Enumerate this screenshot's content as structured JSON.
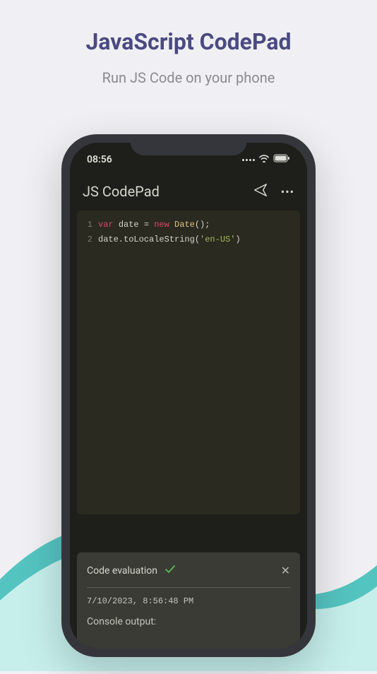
{
  "marketing": {
    "title": "JavaScript CodePad",
    "subtitle": "Run JS Code on your phone"
  },
  "phone": {
    "status_time": "08:56"
  },
  "app": {
    "title": "JS CodePad"
  },
  "code": {
    "lines": [
      {
        "num": "1",
        "tokens": [
          {
            "t": "var ",
            "c": "tok-keyword"
          },
          {
            "t": "date ",
            "c": "tok-var"
          },
          {
            "t": "= ",
            "c": "tok-op"
          },
          {
            "t": "new ",
            "c": "tok-new"
          },
          {
            "t": "Date",
            "c": "tok-class"
          },
          {
            "t": "();",
            "c": "tok-punc"
          }
        ]
      },
      {
        "num": "2",
        "tokens": [
          {
            "t": "date.toLocaleString(",
            "c": "tok-method"
          },
          {
            "t": "'en-US'",
            "c": "tok-string"
          },
          {
            "t": ")",
            "c": "tok-punc"
          }
        ]
      }
    ]
  },
  "output": {
    "header_label": "Code evaluation",
    "result_text": "7/10/2023, 8:56:48 PM",
    "console_label": "Console output:"
  }
}
